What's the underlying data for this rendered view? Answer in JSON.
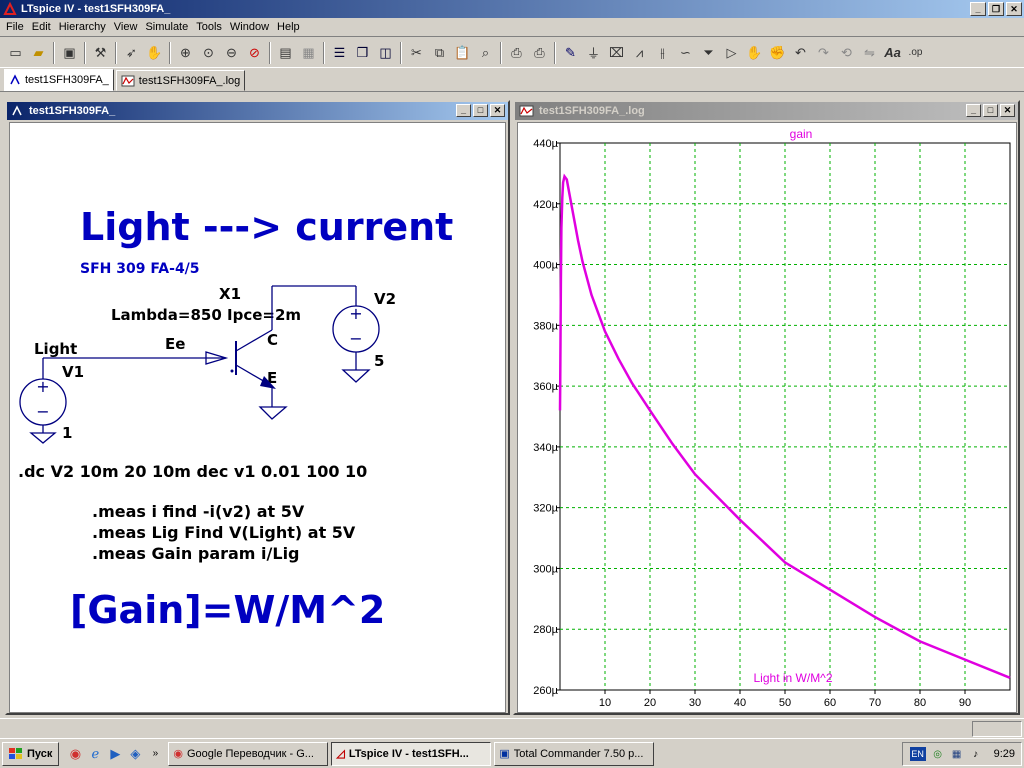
{
  "app": {
    "title": "LTspice IV - test1SFH309FA_"
  },
  "menu": {
    "items": [
      "File",
      "Edit",
      "Hierarchy",
      "View",
      "Simulate",
      "Tools",
      "Window",
      "Help"
    ]
  },
  "tabs": [
    {
      "label": "test1SFH309FA_"
    },
    {
      "label": "test1SFH309FA_.log"
    }
  ],
  "schematic_window": {
    "title": "test1SFH309FA_",
    "heading": "Light ---> current",
    "part": "SFH 309 FA-4/5",
    "x1_label": "X1",
    "x1_params": "Lambda=850 Ipce=2m",
    "v2_label": "V2",
    "v2_value": "5",
    "node_light": "Light",
    "v1_label": "V1",
    "v1_value": "1",
    "net_ee": "Ee",
    "pin_c": "C",
    "pin_e": "E",
    "dc_directive": ".dc V2 10m 20 10m dec v1 0.01 100 10",
    "meas1": ".meas i find -i(v2) at 5V",
    "meas2": ".meas Lig  Find V(Light) at 5V",
    "meas3": ".meas Gain param i/Lig",
    "units": "[Gain]=W/M^2",
    "colors": {
      "blue_text": "#0000c0",
      "wire": "#000080"
    }
  },
  "waveform_window": {
    "title": "test1SFH309FA_.log"
  },
  "chart_data": {
    "type": "line",
    "title": "gain",
    "xlabel": "Light in W/M^2",
    "ylabel": "",
    "xlim": [
      0,
      100
    ],
    "ylim": [
      260,
      440
    ],
    "x_ticks": [
      "10",
      "20",
      "30",
      "40",
      "50",
      "60",
      "70",
      "80",
      "90"
    ],
    "y_ticks": [
      "260µ",
      "280µ",
      "300µ",
      "320µ",
      "340µ",
      "360µ",
      "380µ",
      "400µ",
      "420µ",
      "440µ"
    ],
    "grid": true,
    "series": [
      {
        "color": "#e000e0",
        "x": [
          0.01,
          0.05,
          0.1,
          0.2,
          0.3,
          0.5,
          0.7,
          1,
          1.5,
          2,
          3,
          4,
          5,
          7,
          10,
          13,
          16,
          20,
          25,
          30,
          40,
          50,
          60,
          70,
          80,
          90,
          100
        ],
        "y": [
          352,
          360,
          375,
          395,
          412,
          422,
          427,
          429,
          428,
          424,
          416,
          408,
          401,
          390,
          378,
          369,
          361,
          352,
          341,
          331,
          316,
          302,
          293,
          284,
          276,
          270,
          264
        ]
      }
    ]
  },
  "taskbar": {
    "start": "Пуск",
    "tasks": [
      {
        "label": "Google Переводчик - G..."
      },
      {
        "label": "LTspice IV - test1SFH..."
      },
      {
        "label": "Total Commander 7.50 p..."
      }
    ],
    "lang": "EN",
    "clock": "9:29"
  }
}
